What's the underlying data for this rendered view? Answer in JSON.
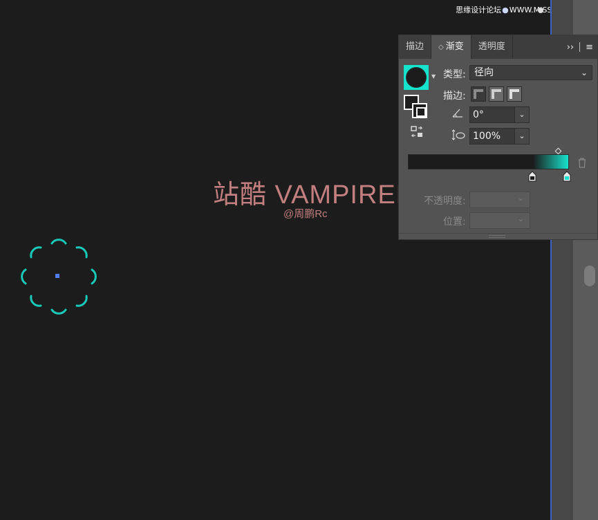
{
  "watermark": {
    "left": "思缘设计论坛",
    "dot": "●",
    "right": "WWW.MISSVUAN.COM"
  },
  "canvas": {
    "title": "站酷 VAMPIREE",
    "subtitle": "@周鹏Rc"
  },
  "panel": {
    "tabs": [
      {
        "label": "描边"
      },
      {
        "label": "渐变",
        "prefix": "◇"
      },
      {
        "label": "透明度"
      }
    ],
    "menu_expand": "››",
    "menu_icon": "≡",
    "type_label": "类型:",
    "type_value": "径向",
    "stroke_label": "描边:",
    "angle_value": "0°",
    "aspect_value": "100%",
    "opacity_label": "不透明度:",
    "position_label": "位置:"
  },
  "colors": {
    "accent": "#15e3cd",
    "panel_bg": "#535353",
    "canvas_bg": "#1c1c1c",
    "text_overlay": "#c37f7f"
  },
  "icons": [
    "angle-icon",
    "aspect-ratio-icon",
    "reverse-gradient-icon",
    "trash-icon",
    "chevron-down-icon",
    "panel-menu-icon"
  ]
}
